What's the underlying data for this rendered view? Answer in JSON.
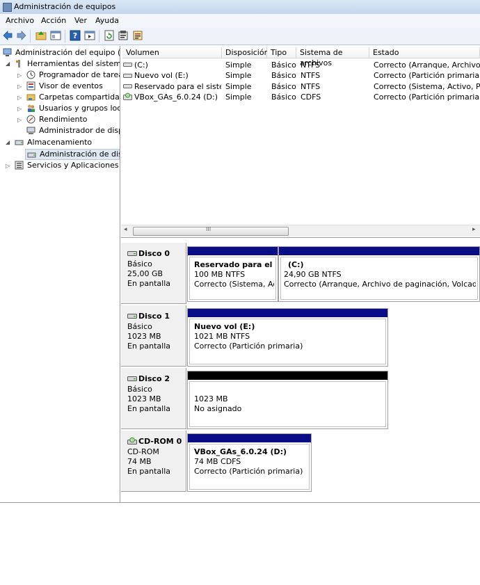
{
  "window": {
    "title": "Administración de equipos"
  },
  "menu": [
    "Archivo",
    "Acción",
    "Ver",
    "Ayuda"
  ],
  "tree": {
    "root": "Administración del equipo (loc",
    "system_tools": "Herramientas del sistema",
    "task_scheduler": "Programador de tareas",
    "event_viewer": "Visor de eventos",
    "shared_folders": "Carpetas compartidas",
    "local_users": "Usuarios y grupos locale",
    "performance": "Rendimiento",
    "device_manager": "Administrador de dispo",
    "storage": "Almacenamiento",
    "disk_management": "Administración de disco",
    "services_apps": "Servicios y Aplicaciones"
  },
  "columns": [
    "Volumen",
    "Disposición",
    "Tipo",
    "Sistema de archivos",
    "Estado"
  ],
  "volumes": [
    [
      "(C:)",
      "Simple",
      "Básico",
      "NTFS",
      "Correcto (Arranque, Archivo de"
    ],
    [
      "Nuevo vol (E:)",
      "Simple",
      "Básico",
      "NTFS",
      "Correcto (Partición primaria)"
    ],
    [
      "Reservado para el sistema",
      "Simple",
      "Básico",
      "NTFS",
      "Correcto (Sistema, Activo, Partic"
    ],
    [
      "VBox_GAs_6.0.24 (D:)",
      "Simple",
      "Básico",
      "CDFS",
      "Correcto (Partición primaria)"
    ]
  ],
  "scroll_thumb": "III",
  "disks": [
    {
      "name": "Disco 0",
      "type": "Básico",
      "size": "25,00 GB",
      "status": "En pantalla",
      "partitions": [
        {
          "name": "Reservado para el sister",
          "size": "100 MB NTFS",
          "status": "Correcto (Sistema, Activo"
        },
        {
          "name": "(C:)",
          "size": "24,90 GB NTFS",
          "status": "Correcto (Arranque, Archivo de paginación, Volcado, Part"
        }
      ]
    },
    {
      "name": "Disco 1",
      "type": "Básico",
      "size": "1023 MB",
      "status": "En pantalla",
      "partitions": [
        {
          "name": "Nuevo vol  (E:)",
          "size": "1021 MB NTFS",
          "status": "Correcto (Partición primaria)"
        }
      ]
    },
    {
      "name": "Disco 2",
      "type": "Básico",
      "size": "1023 MB",
      "status": "En pantalla",
      "partitions": [
        {
          "size": "1023 MB",
          "status": "No asignado"
        }
      ]
    },
    {
      "name": "CD-ROM 0",
      "type": "CD-ROM",
      "size": "74 MB",
      "status": "En pantalla",
      "partitions": [
        {
          "name": "VBox_GAs_6.0.24  (D:)",
          "size": "74 MB CDFS",
          "status": "Correcto (Partición primaria)"
        }
      ]
    }
  ],
  "colors": {
    "primary_partition": "#0b0d87",
    "unallocated": "#000000"
  }
}
